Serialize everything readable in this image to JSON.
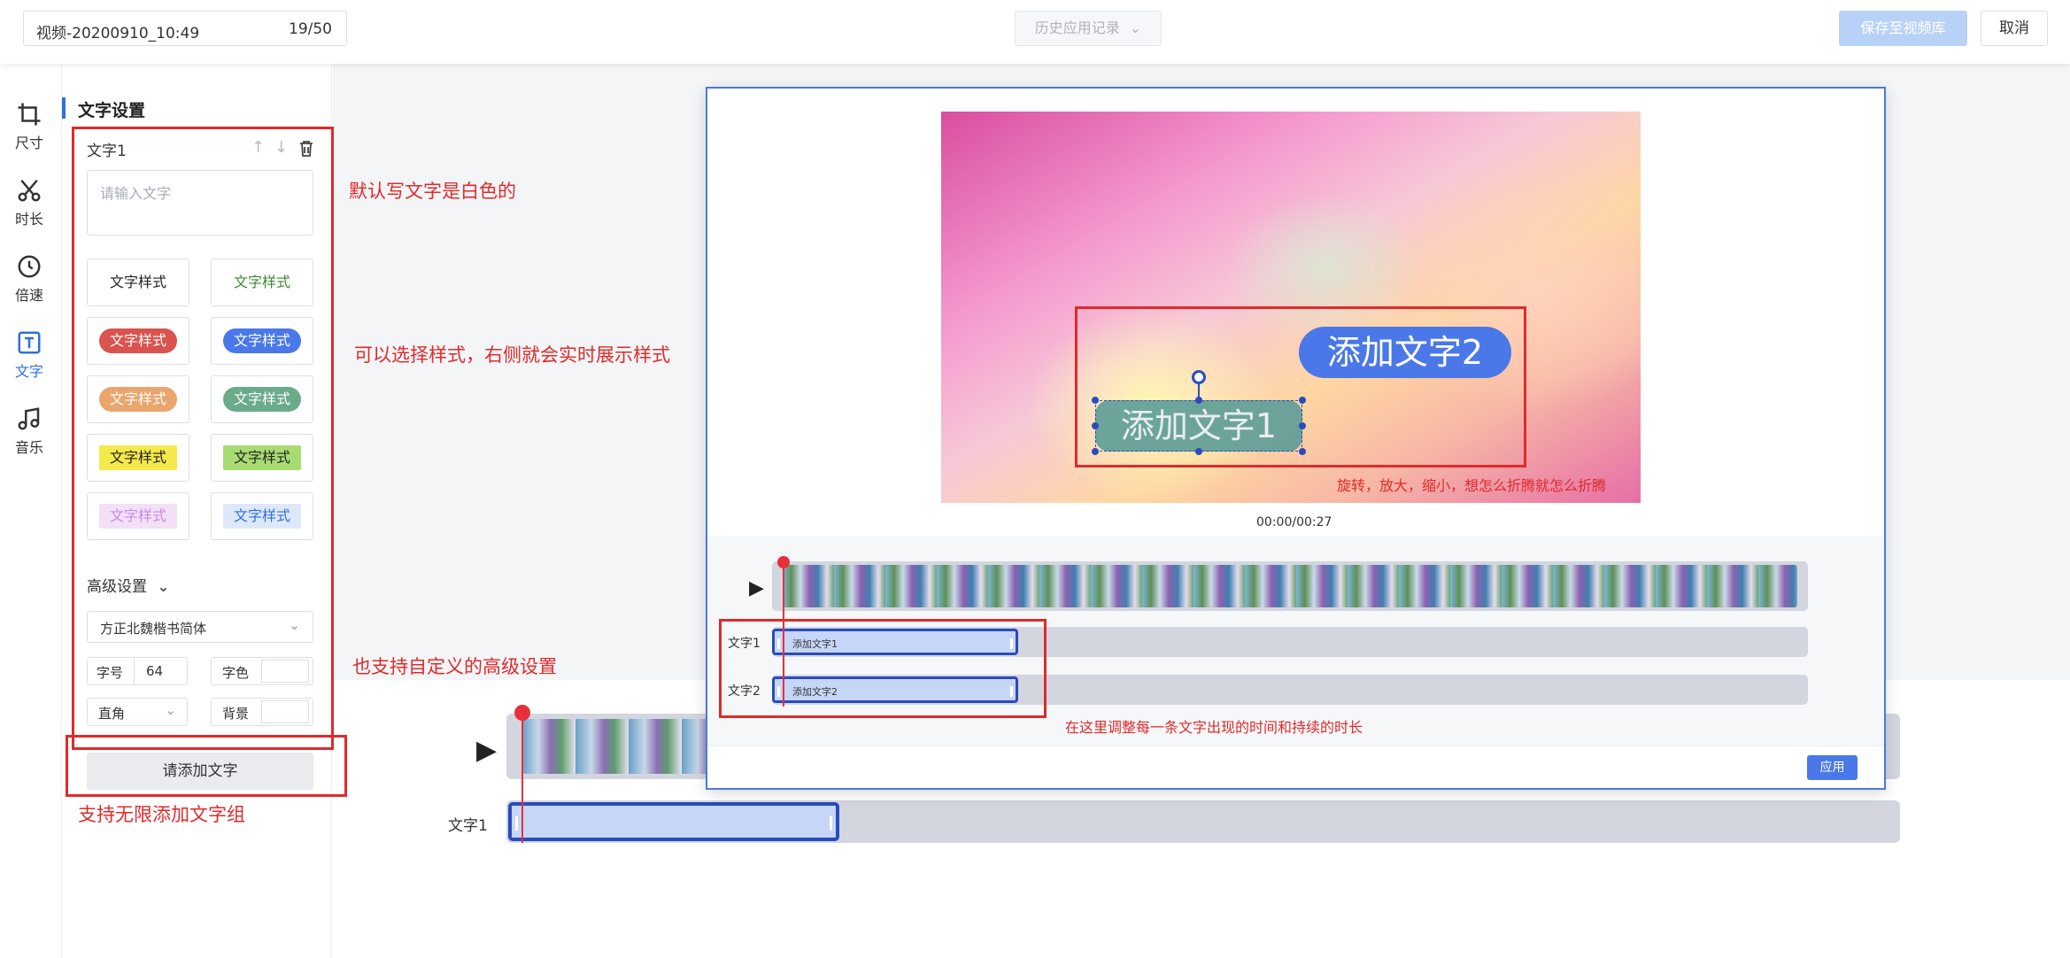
{
  "topbar": {
    "title": "视频-20200910_10:49",
    "title_count": "19/50",
    "history_label": "历史应用记录",
    "save_label": "保存至视频库",
    "cancel_label": "取消"
  },
  "toolbar": {
    "items": [
      {
        "label": "尺寸",
        "icon": "crop-icon"
      },
      {
        "label": "时长",
        "icon": "scissors-icon"
      },
      {
        "label": "倍速",
        "icon": "clock-icon"
      },
      {
        "label": "文字",
        "icon": "text-icon"
      },
      {
        "label": "音乐",
        "icon": "music-icon"
      }
    ],
    "active": "文字"
  },
  "panel": {
    "title": "文字设置",
    "group_label": "文字1",
    "input_placeholder": "请输入文字",
    "styles": [
      {
        "label": "文字样式",
        "text_color": "#222222",
        "bg": "transparent"
      },
      {
        "label": "文字样式",
        "text_color": "#3c8a2e",
        "bg": "transparent"
      },
      {
        "label": "文字样式",
        "text_color": "#ffffff",
        "bg": "#d9534f"
      },
      {
        "label": "文字样式",
        "text_color": "#ffffff",
        "bg": "#4a78e8"
      },
      {
        "label": "文字样式",
        "text_color": "#ffffff",
        "bg": "#eaa56d"
      },
      {
        "label": "文字样式",
        "text_color": "#ffffff",
        "bg": "#6aab8a"
      },
      {
        "label": "文字样式",
        "text_color": "#222222",
        "bg": "#f4e94a"
      },
      {
        "label": "文字样式",
        "text_color": "#222222",
        "bg": "#a7dc73"
      },
      {
        "label": "文字样式",
        "text_color": "#c48ae6",
        "bg": "#f3e0f7"
      },
      {
        "label": "文字样式",
        "text_color": "#2f6fe0",
        "bg": "#dde9fa"
      }
    ],
    "advanced_label": "高级设置",
    "font_name": "方正北魏楷书简体",
    "size_label": "字号",
    "size_value": "64",
    "color_label": "字色",
    "corner_value": "直角",
    "bg_label": "背景",
    "add_button": "请添加文字"
  },
  "preview": {
    "text2": "添加文字2",
    "text1": "添加文字1",
    "time": "00:00/00:27",
    "track1_label": "文字1",
    "track2_label": "文字2",
    "clip1_text": "添加文字1",
    "clip2_text": "添加文字2",
    "apply_label": "应用"
  },
  "background_timeline": {
    "track_label": "文字1"
  },
  "annotations": {
    "default_white": "默认写文字是白色的",
    "choose_style": "可以选择样式，右侧就会实时展示样式",
    "advanced": "也支持自定义的高级设置",
    "unlimited": "支持无限添加文字组",
    "transform": "旋转，放大，缩小，想怎么折腾就怎么折腾",
    "timing": "在这里调整每一条文字出现的时间和持续的时长"
  },
  "colors": {
    "accent": "#2f6fe0",
    "annotation_red": "#e02a2a",
    "clip_border": "#2b4bbd"
  }
}
